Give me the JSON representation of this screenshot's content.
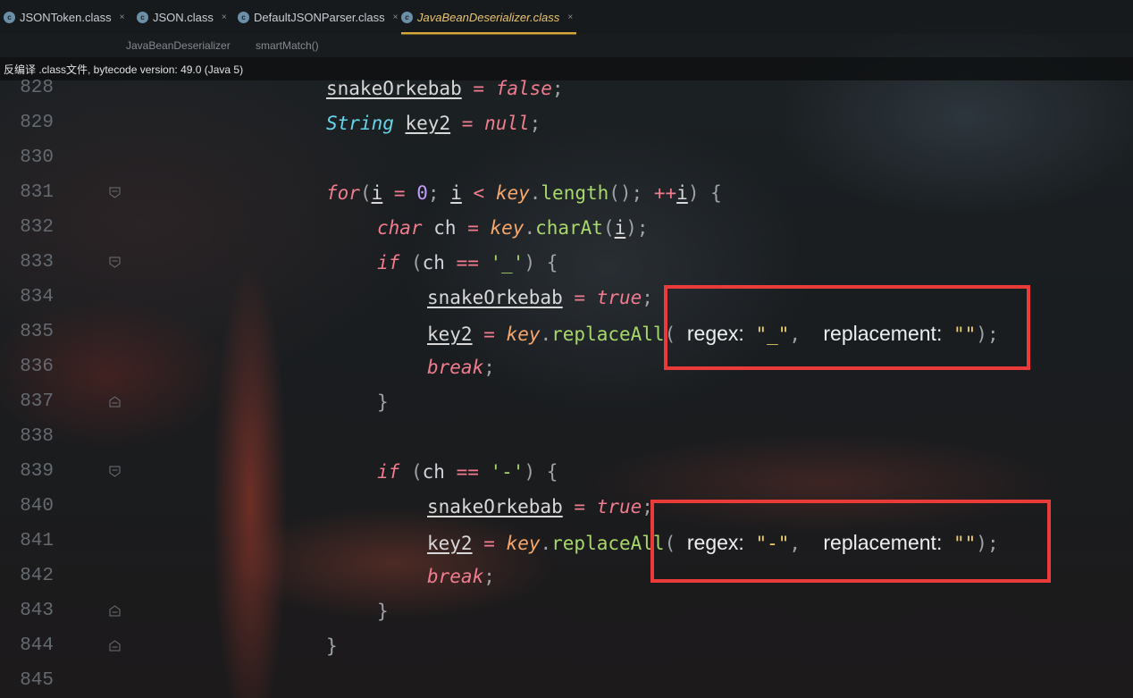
{
  "tabs": [
    {
      "label": "JSONToken.class",
      "active": false
    },
    {
      "label": "JSON.class",
      "active": false
    },
    {
      "label": "DefaultJSONParser.class",
      "active": false
    },
    {
      "label": "JavaBeanDeserializer.class",
      "active": true
    }
  ],
  "tab_close_symbol": "×",
  "breadcrumb": [
    "JavaBeanDeserializer",
    "smartMatch()"
  ],
  "banner": "反编译 .class文件, bytecode version: 49.0 (Java 5)",
  "line_numbers": [
    "828",
    "829",
    "830",
    "831",
    "832",
    "833",
    "834",
    "835",
    "836",
    "837",
    "838",
    "839",
    "840",
    "841",
    "842",
    "843",
    "844",
    "845"
  ],
  "code": {
    "l828": {
      "var": "snakeOrkebab",
      "eq": "=",
      "val": "false",
      "semi": ";"
    },
    "l829": {
      "type": "String",
      "var": "key2",
      "eq": "=",
      "val": "null",
      "semi": ";"
    },
    "l831": {
      "kw": "for",
      "open": "(",
      "i1": "i",
      "eq": "=",
      "zero": "0",
      "semi1": ";",
      "i2": "i",
      "lt": "<",
      "key": "key",
      "dot": ".",
      "method": "length",
      "call": "();",
      "inc": "++",
      "i3": "i",
      "close": ")",
      "brace": "{"
    },
    "l832": {
      "type": "char",
      "var": "ch",
      "eq": "=",
      "key": "key",
      "dot": ".",
      "method": "charAt",
      "open": "(",
      "arg": "i",
      "close": ");"
    },
    "l833": {
      "kw": "if",
      "open": "(",
      "var": "ch",
      "op": "==",
      "lit": "'_'",
      "close": ")",
      "brace": "{"
    },
    "l834": {
      "var": "snakeOrkebab",
      "eq": "=",
      "val": "true",
      "semi": ";"
    },
    "l835": {
      "var": "key2",
      "eq": "=",
      "key": "key",
      "dot": ".",
      "method": "replaceAll",
      "open": "(",
      "hint1": "regex:",
      "arg1": "\"_\"",
      "comma": ",",
      "hint2": "replacement:",
      "arg2": "\"\"",
      "close": ");"
    },
    "l836": {
      "kw": "break",
      "semi": ";"
    },
    "l837": {
      "brace": "}"
    },
    "l839": {
      "kw": "if",
      "open": "(",
      "var": "ch",
      "op": "==",
      "lit": "'-'",
      "close": ")",
      "brace": "{"
    },
    "l840": {
      "var": "snakeOrkebab",
      "eq": "=",
      "val": "true",
      "semi": ";"
    },
    "l841": {
      "var": "key2",
      "eq": "=",
      "key": "key",
      "dot": ".",
      "method": "replaceAll",
      "open": "(",
      "hint1": "regex:",
      "arg1": "\"-\"",
      "comma": ",",
      "hint2": "replacement:",
      "arg2": "\"\"",
      "close": ");"
    },
    "l842": {
      "kw": "break",
      "semi": ";"
    },
    "l843": {
      "brace": "}"
    },
    "l844": {
      "brace": "}"
    }
  },
  "colors": {
    "keyword": "#f07c8e",
    "type": "#66d4e8",
    "parameter": "#f5a66b",
    "method": "#a8d86a",
    "number": "#c59cf5",
    "string": "#f0d06a",
    "highlight_box": "#ea3b3b",
    "active_tab": "#e8c46d"
  },
  "icons": {
    "tab_file_icon": "java-class-file-icon",
    "fold_marker": "code-fold-icon"
  }
}
